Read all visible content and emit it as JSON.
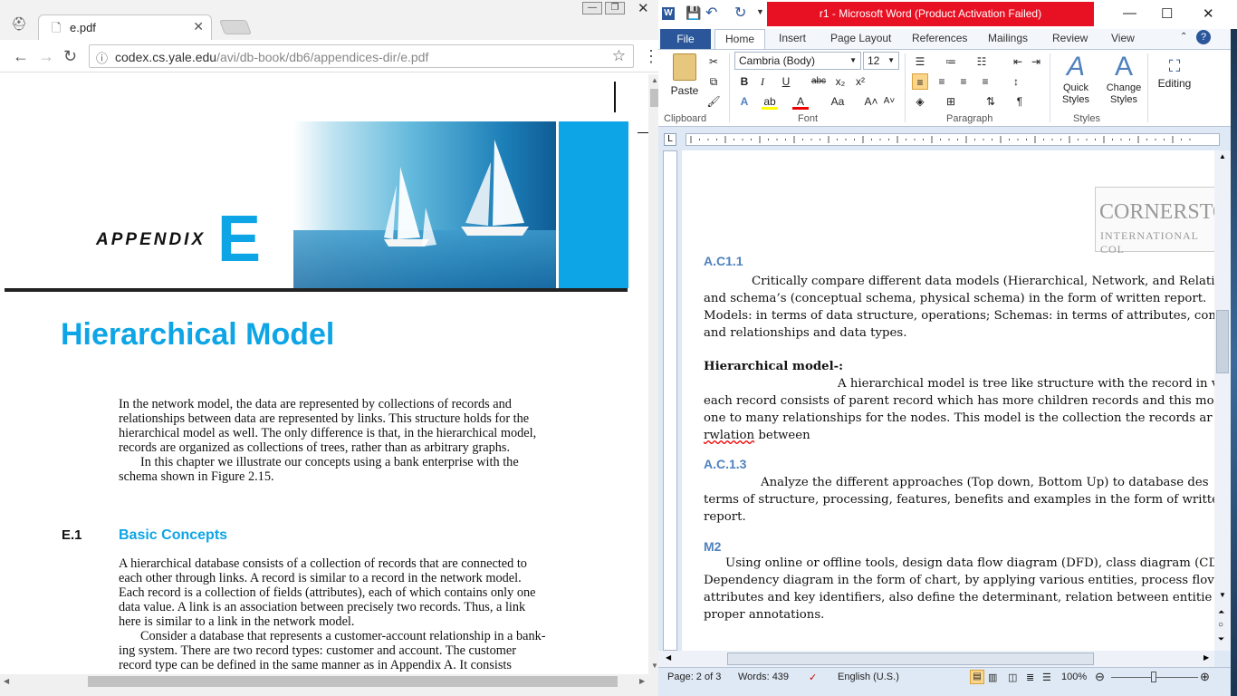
{
  "browser": {
    "tab_title": "e.pdf",
    "tab_close": "✕",
    "url_host": "codex.cs.yale.edu",
    "url_path": "/avi/db-book/db6/appendices-dir/e.pdf",
    "back": "←",
    "forward": "→",
    "reload": "↻",
    "star": "☆",
    "menu": "⋮"
  },
  "pdf": {
    "appendix_word": "APPENDIX",
    "appendix_letter": "E",
    "title": "Hierarchical Model",
    "para1_lines": [
      "In the network model, the data are represented by collections of records and",
      "relationships between data are represented by links. This structure holds for the",
      "hierarchical model as well. The only difference is that, in the hierarchical model,",
      "records are organized as collections of trees, rather than as arbitrary graphs.",
      "In this chapter we illustrate our concepts using a bank enterprise with the",
      "schema shown in Figure 2.15."
    ],
    "section_number": "E.1",
    "section_title": "Basic Concepts",
    "para2_lines": [
      "A hierarchical database consists of a collection of records that are connected to",
      "each other through links. A record is similar to a record in the network model.",
      "Each record is a collection of fields (attributes), each of which contains only one",
      "data value. A link is an association between precisely two records. Thus, a link",
      "here is similar to a link in the network model.",
      "Consider a database that represents a customer-account relationship in a bank-",
      "ing system. There are two record types: customer and account. The customer",
      "record type can be defined in the same manner as in Appendix A. It consists"
    ]
  },
  "word": {
    "title": "r1  -  Microsoft Word (Product Activation Failed)",
    "tabs": [
      "File",
      "Home",
      "Insert",
      "Page Layout",
      "References",
      "Mailings",
      "Review",
      "View"
    ],
    "font_name": "Cambria (Body)",
    "font_size": "12",
    "groups": [
      "Clipboard",
      "Font",
      "Paragraph",
      "Styles"
    ],
    "paste": "Paste",
    "quick_styles": "Quick Styles",
    "change_styles": "Change Styles",
    "editing": "Editing",
    "logo_main": "CORNERSTO",
    "logo_sub": "INTERNATIONAL COL",
    "headings": [
      "A.C1.1",
      "A.C.1.3",
      "M2"
    ],
    "ac11_lines": [
      "Critically  compare different data models (Hierarchical, Network, and Relati",
      "and schema’s (conceptual schema, physical schema) in the form of written  report.",
      "Models: in terms of data structure, operations; Schemas: in terms of attributes, con",
      "and relationships and data types."
    ],
    "hier_heading": "Hierarchical model-:",
    "hier_lines": [
      "A hierarchical model is tree like structure with the record in v",
      "each record consists of parent record which has more children records and this mo",
      "one to many relationships for the nodes. This model is the collection the records ar",
      "between"
    ],
    "hier_misspelled": "rwlation",
    "ac13_lines": [
      "Analyze the different approaches (Top down, Bottom Up) to database des",
      "terms of structure, processing, features, benefits and examples in the form of writte",
      "report."
    ],
    "m2_lines": [
      "Using online or offline tools, design data flow diagram (DFD), class diagram (CD",
      "Dependency diagram in the form of chart, by applying various entities, process flov",
      "attributes and key identifiers, also define the determinant, relation between entitie",
      "proper annotations."
    ],
    "status": {
      "page": "Page: 2 of 3",
      "words": "Words: 439",
      "language": "English (U.S.)",
      "zoom": "100%"
    }
  }
}
